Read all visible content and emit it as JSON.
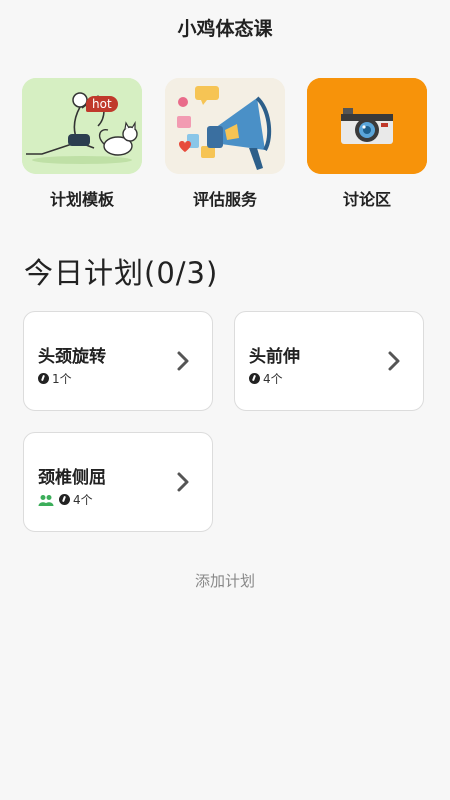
{
  "header": {
    "title": "小鸡体态课"
  },
  "features": [
    {
      "label": "计划模板",
      "badge": "hot",
      "icon": "yoga-cat-illustration"
    },
    {
      "label": "评估服务",
      "icon": "megaphone-illustration"
    },
    {
      "label": "讨论区",
      "icon": "camera-icon"
    }
  ],
  "section": {
    "title": "今日计划",
    "progress": "(0/3)"
  },
  "plans": [
    {
      "name": "头颈旋转",
      "count": "1个"
    },
    {
      "name": "头前伸",
      "count": "4个"
    },
    {
      "name": "颈椎侧屈",
      "count": "4个"
    }
  ],
  "actions": {
    "add_plan": "添加计划"
  },
  "colors": {
    "camera_tile": "#f7930a",
    "yoga_tile": "#d6efc2",
    "megaphone_tile": "#f4efe4",
    "hot_badge": "#c0392b"
  }
}
